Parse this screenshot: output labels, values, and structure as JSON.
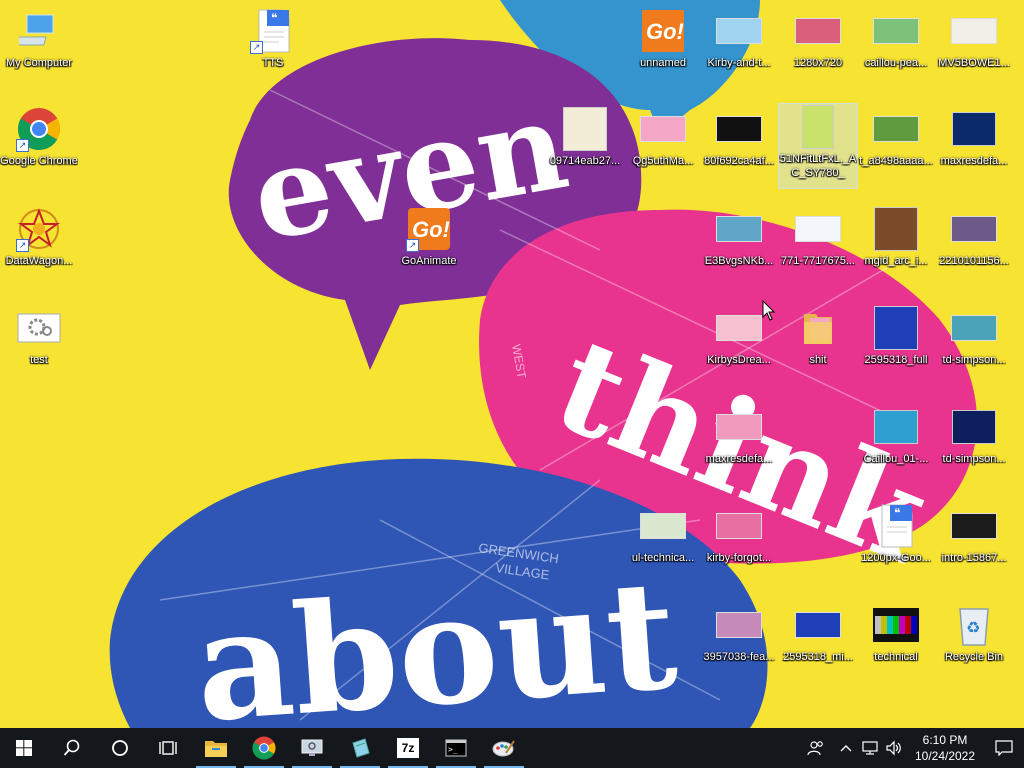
{
  "wallpaper": {
    "background": "#f7e331",
    "word_even": "even",
    "word_think": "think",
    "word_about": "about",
    "map_label_1": "GREENWICH",
    "map_label_2": "VILLAGE",
    "map_label_3": "WEST"
  },
  "desktop": {
    "icons": [
      {
        "label": "My Computer",
        "icon": "computer-icon"
      },
      {
        "label": "TTS",
        "icon": "document-shortcut-icon"
      },
      {
        "label": "unnamed",
        "icon": "goanimate-image-icon"
      },
      {
        "label": "Kirby-and-t...",
        "icon": "image-thumbnail-icon"
      },
      {
        "label": "1280x720",
        "icon": "image-thumbnail-icon"
      },
      {
        "label": "caillou-pea...",
        "icon": "image-thumbnail-icon"
      },
      {
        "label": "MV5BOWE1...",
        "icon": "image-thumbnail-icon"
      },
      {
        "label": "Google Chrome",
        "icon": "chrome-icon"
      },
      {
        "label": "09714eab27...",
        "icon": "image-thumbnail-icon"
      },
      {
        "label": "Qg5uthMa...",
        "icon": "image-thumbnail-icon"
      },
      {
        "label": "80f692ca4af...",
        "icon": "image-thumbnail-icon"
      },
      {
        "label": "51NFitLtFxL._AC_SY780_",
        "icon": "image-thumbnail-icon"
      },
      {
        "label": "t_a8498aaaa...",
        "icon": "image-thumbnail-icon"
      },
      {
        "label": "maxresdefa...",
        "icon": "image-thumbnail-icon"
      },
      {
        "label": "DataWagon...",
        "icon": "datawagon-icon"
      },
      {
        "label": "GoAnimate",
        "icon": "goanimate-shortcut-icon"
      },
      {
        "label": "E3BvgsNKb...",
        "icon": "image-thumbnail-icon"
      },
      {
        "label": "771-7717675...",
        "icon": "image-thumbnail-icon"
      },
      {
        "label": "mgid_arc_i...",
        "icon": "image-thumbnail-icon"
      },
      {
        "label": "2210101156...",
        "icon": "image-thumbnail-icon"
      },
      {
        "label": "test",
        "icon": "settings-file-icon"
      },
      {
        "label": "KirbysDrea...",
        "icon": "image-thumbnail-icon"
      },
      {
        "label": "shit",
        "icon": "folder-icon"
      },
      {
        "label": "2595318_full",
        "icon": "image-thumbnail-icon"
      },
      {
        "label": "td-simpson...",
        "icon": "image-thumbnail-icon"
      },
      {
        "label": "maxresdefa...",
        "icon": "image-thumbnail-icon"
      },
      {
        "label": "Caillou_01-...",
        "icon": "image-thumbnail-icon"
      },
      {
        "label": "td-simpson...",
        "icon": "image-thumbnail-icon"
      },
      {
        "label": "ul-technica...",
        "icon": "image-thumbnail-icon"
      },
      {
        "label": "kirby-forgot...",
        "icon": "image-thumbnail-icon"
      },
      {
        "label": "1200px-Goo...",
        "icon": "document-shortcut-icon"
      },
      {
        "label": "intro-15867...",
        "icon": "image-thumbnail-icon"
      },
      {
        "label": "3957038-fea...",
        "icon": "image-thumbnail-icon"
      },
      {
        "label": "2595318_mi...",
        "icon": "image-thumbnail-icon"
      },
      {
        "label": "technical",
        "icon": "image-thumbnail-icon"
      },
      {
        "label": "Recycle Bin",
        "icon": "recycle-bin-icon"
      }
    ]
  },
  "taskbar": {
    "start": "windows-logo-icon",
    "search": "search-icon",
    "cortana": "cortana-circle-icon",
    "task_view": "task-view-icon",
    "apps": [
      "file-explorer-icon",
      "chrome-icon",
      "display-settings-icon",
      "notepad-icon",
      "7zip-icon",
      "command-prompt-icon",
      "paint-icon"
    ],
    "app_7zip_label": "7z",
    "tray": {
      "people": "people-icon",
      "chevron": "chevron-up-icon",
      "network": "network-icon",
      "volume": "volume-icon",
      "time": "6:10 PM",
      "date": "10/24/2022",
      "notifications": "action-center-icon"
    }
  }
}
